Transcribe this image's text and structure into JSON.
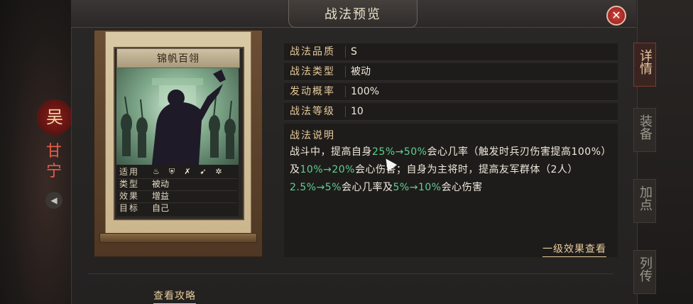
{
  "hero": {
    "badge": "吴",
    "name": "甘宁",
    "speaker_icon": "speaker-icon"
  },
  "window": {
    "title": "战法预览",
    "close_icon": "close-icon"
  },
  "side_tabs": [
    {
      "label": "详情",
      "active": true
    },
    {
      "label": "装备",
      "active": false
    },
    {
      "label": "加点",
      "active": false
    },
    {
      "label": "列传",
      "active": false
    }
  ],
  "card": {
    "title": "锦帆百翎",
    "stats": [
      {
        "label": "适用",
        "icons": [
          "fire-icon",
          "shield-icon",
          "crossbow-icon",
          "spear-icon",
          "wheel-icon"
        ]
      },
      {
        "label": "类型",
        "value": "被动"
      },
      {
        "label": "效果",
        "value": "增益"
      },
      {
        "label": "目标",
        "value": "自己"
      }
    ]
  },
  "attributes": [
    {
      "label": "战法品质",
      "value": "S"
    },
    {
      "label": "战法类型",
      "value": "被动"
    },
    {
      "label": "发动概率",
      "value": "100%"
    },
    {
      "label": "战法等级",
      "value": "10"
    }
  ],
  "description": {
    "label": "战法说明",
    "segments": [
      {
        "text": "战斗中，提高自身",
        "hl": false
      },
      {
        "text": "25%→50%",
        "hl": true
      },
      {
        "text": "会心几率（触发时兵刃伤害提高100%）及",
        "hl": false
      },
      {
        "text": "10%→20%",
        "hl": true
      },
      {
        "text": "会心伤害；自身为主将时，提高友军群体（2人）",
        "hl": false
      },
      {
        "text": "2.5%→5%",
        "hl": true
      },
      {
        "text": "会心几率及",
        "hl": false
      },
      {
        "text": "5%→10%",
        "hl": true
      },
      {
        "text": "会心伤害",
        "hl": false
      }
    ],
    "link": "一级效果查看"
  },
  "guide_link": "查看攻略",
  "colors": {
    "highlight": "#5fcf8e",
    "label_gold": "#e6ca9a",
    "accent_red": "#d0453d"
  }
}
